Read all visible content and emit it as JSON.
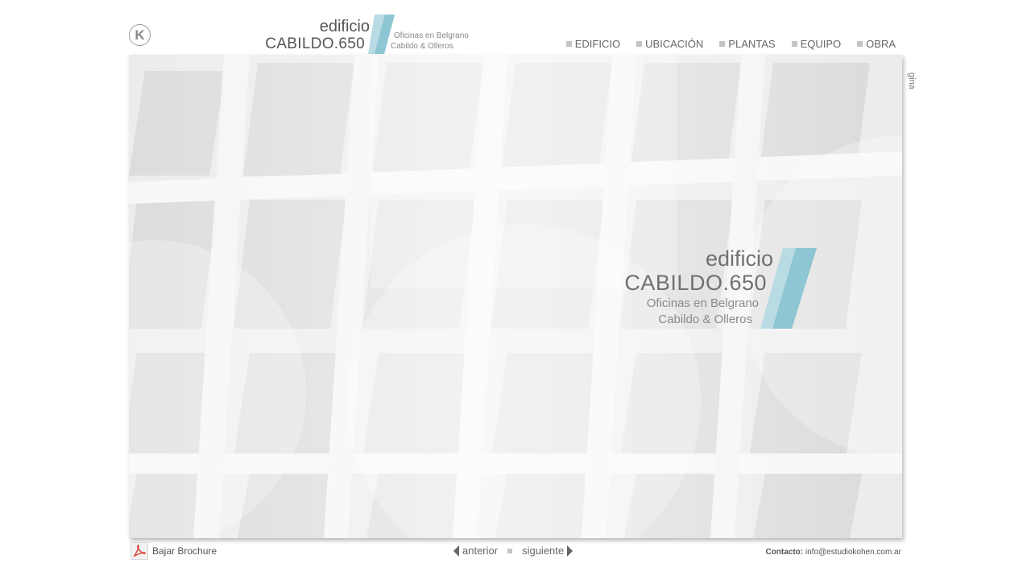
{
  "header": {
    "logo_letter": "K",
    "brand": {
      "line1": "edificio",
      "line2": "CABILDO.650",
      "sub1": "Oficinas en Belgrano",
      "sub2": "Cabildo & Olleros"
    },
    "nav": [
      {
        "label": "EDIFICIO"
      },
      {
        "label": "UBICACIÓN"
      },
      {
        "label": "PLANTAS"
      },
      {
        "label": "EQUIPO"
      },
      {
        "label": "OBRA"
      }
    ]
  },
  "hero": {
    "line1": "edificio",
    "line2": "CABILDO.650",
    "sub1": "Oficinas en Belgrano",
    "sub2": "Cabildo & Olleros"
  },
  "side_tab": "gina",
  "footer": {
    "brochure_label": "Bajar Brochure",
    "prev_label": "anterior",
    "next_label": "siguiente",
    "contact_label": "Contacto:",
    "contact_email": "info@estudiokohen.com.ar"
  },
  "colors": {
    "accent_teal": "#7fbfcf",
    "text_gray": "#666666"
  }
}
